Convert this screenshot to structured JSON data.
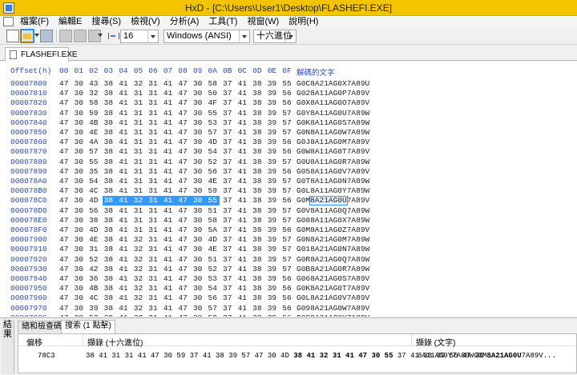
{
  "window": {
    "title": "HxD - [C:\\Users\\User1\\Desktop\\FLASHEFI.EXE]"
  },
  "menu": [
    "檔案(F)",
    "編輯E",
    "搜尋(S)",
    "檢視(V)",
    "分析(A)",
    "工具(T)",
    "視窗(W)",
    "說明(H)"
  ],
  "toolbar": {
    "bytes_per_row": "16",
    "charset": "Windows (ANSI)",
    "offset_base": "十六進位"
  },
  "file_tab": "FLASHEFI.EXE",
  "editor": {
    "offset_header": "Offset(h)",
    "column_headers": [
      "00",
      "01",
      "02",
      "03",
      "04",
      "05",
      "06",
      "07",
      "08",
      "09",
      "0A",
      "0B",
      "0C",
      "0D",
      "0E",
      "0F"
    ],
    "text_header": "解碼的文字",
    "rows": [
      {
        "offset": "00007800",
        "hex": [
          "47",
          "30",
          "43",
          "38",
          "41",
          "32",
          "31",
          "41",
          "47",
          "30",
          "58",
          "37",
          "41",
          "38",
          "39",
          "55"
        ],
        "text": "G0C8A21AG0X7A89U"
      },
      {
        "offset": "00007810",
        "hex": [
          "47",
          "30",
          "32",
          "38",
          "41",
          "31",
          "31",
          "41",
          "47",
          "30",
          "50",
          "37",
          "41",
          "38",
          "39",
          "56"
        ],
        "text": "G028A11AG0P7A89V"
      },
      {
        "offset": "00007820",
        "hex": [
          "47",
          "30",
          "58",
          "38",
          "41",
          "31",
          "31",
          "41",
          "47",
          "30",
          "4F",
          "37",
          "41",
          "38",
          "39",
          "56"
        ],
        "text": "G0X8A11AG0O7A89V"
      },
      {
        "offset": "00007830",
        "hex": [
          "47",
          "30",
          "59",
          "38",
          "41",
          "31",
          "31",
          "41",
          "47",
          "30",
          "55",
          "37",
          "41",
          "38",
          "39",
          "57"
        ],
        "text": "G0Y8A11AG0U7A89W"
      },
      {
        "offset": "00007840",
        "hex": [
          "47",
          "30",
          "4B",
          "38",
          "41",
          "31",
          "31",
          "41",
          "47",
          "30",
          "53",
          "37",
          "41",
          "38",
          "39",
          "57"
        ],
        "text": "G0K8A11AG0S7A89W"
      },
      {
        "offset": "00007850",
        "hex": [
          "47",
          "30",
          "4E",
          "38",
          "41",
          "31",
          "31",
          "41",
          "47",
          "30",
          "57",
          "37",
          "41",
          "38",
          "39",
          "57"
        ],
        "text": "G0N8A11AG0W7A89W"
      },
      {
        "offset": "00007860",
        "hex": [
          "47",
          "30",
          "4A",
          "38",
          "41",
          "31",
          "31",
          "41",
          "47",
          "30",
          "4D",
          "37",
          "41",
          "38",
          "39",
          "56"
        ],
        "text": "G0J8A11AG0M7A89V"
      },
      {
        "offset": "00007870",
        "hex": [
          "47",
          "30",
          "57",
          "38",
          "41",
          "31",
          "31",
          "41",
          "47",
          "30",
          "54",
          "37",
          "41",
          "38",
          "39",
          "56"
        ],
        "text": "G0W8A11AG0T7A89V"
      },
      {
        "offset": "00007880",
        "hex": [
          "47",
          "30",
          "55",
          "38",
          "41",
          "31",
          "31",
          "41",
          "47",
          "30",
          "52",
          "37",
          "41",
          "38",
          "39",
          "57"
        ],
        "text": "G0U8A11AG0R7A89W"
      },
      {
        "offset": "00007890",
        "hex": [
          "47",
          "30",
          "35",
          "38",
          "41",
          "31",
          "31",
          "41",
          "47",
          "30",
          "56",
          "37",
          "41",
          "38",
          "39",
          "56"
        ],
        "text": "G058A11AG0V7A89V"
      },
      {
        "offset": "000078A0",
        "hex": [
          "47",
          "30",
          "54",
          "38",
          "41",
          "31",
          "31",
          "41",
          "47",
          "30",
          "4E",
          "37",
          "41",
          "38",
          "39",
          "57"
        ],
        "text": "G0T8A11AG0N7A89W"
      },
      {
        "offset": "000078B0",
        "hex": [
          "47",
          "30",
          "4C",
          "38",
          "41",
          "31",
          "31",
          "41",
          "47",
          "30",
          "59",
          "37",
          "41",
          "38",
          "39",
          "57"
        ],
        "text": "G0L8A11AG0Y7A89W"
      },
      {
        "offset": "000078C0",
        "hex": [
          "47",
          "30",
          "4D",
          "38",
          "41",
          "32",
          "31",
          "41",
          "47",
          "30",
          "55",
          "37",
          "41",
          "38",
          "39",
          "56"
        ],
        "text": "G0M8A21AG0U7A89V",
        "selected": true
      },
      {
        "offset": "000078D0",
        "hex": [
          "47",
          "30",
          "56",
          "38",
          "41",
          "31",
          "31",
          "41",
          "47",
          "30",
          "51",
          "37",
          "41",
          "38",
          "39",
          "57"
        ],
        "text": "G0V8A11AG0Q7A89W"
      },
      {
        "offset": "000078E0",
        "hex": [
          "47",
          "30",
          "38",
          "38",
          "41",
          "31",
          "31",
          "41",
          "47",
          "30",
          "58",
          "37",
          "41",
          "38",
          "39",
          "57"
        ],
        "text": "G088A11AG0X7A89W"
      },
      {
        "offset": "000078F0",
        "hex": [
          "47",
          "30",
          "4D",
          "38",
          "41",
          "31",
          "31",
          "41",
          "47",
          "30",
          "5A",
          "37",
          "41",
          "38",
          "39",
          "56"
        ],
        "text": "G0M8A11AG0Z7A89V"
      },
      {
        "offset": "00007900",
        "hex": [
          "47",
          "30",
          "4E",
          "38",
          "41",
          "32",
          "31",
          "41",
          "47",
          "30",
          "4D",
          "37",
          "41",
          "38",
          "39",
          "57"
        ],
        "text": "G0N8A21AG0M7A89W"
      },
      {
        "offset": "00007910",
        "hex": [
          "47",
          "30",
          "31",
          "38",
          "41",
          "32",
          "31",
          "41",
          "47",
          "30",
          "4E",
          "37",
          "41",
          "38",
          "39",
          "57"
        ],
        "text": "G018A21AG0N7A89W"
      },
      {
        "offset": "00007920",
        "hex": [
          "47",
          "30",
          "52",
          "38",
          "41",
          "32",
          "31",
          "41",
          "47",
          "30",
          "51",
          "37",
          "41",
          "38",
          "39",
          "57"
        ],
        "text": "G0R8A21AG0Q7A89W"
      },
      {
        "offset": "00007930",
        "hex": [
          "47",
          "30",
          "42",
          "38",
          "41",
          "32",
          "31",
          "41",
          "47",
          "30",
          "52",
          "37",
          "41",
          "38",
          "39",
          "57"
        ],
        "text": "G0B8A21AG0R7A89W"
      },
      {
        "offset": "00007940",
        "hex": [
          "47",
          "30",
          "36",
          "38",
          "41",
          "32",
          "31",
          "41",
          "47",
          "30",
          "53",
          "37",
          "41",
          "38",
          "39",
          "56"
        ],
        "text": "G068A21AG0S7A89V"
      },
      {
        "offset": "00007950",
        "hex": [
          "47",
          "30",
          "4B",
          "38",
          "41",
          "32",
          "31",
          "41",
          "47",
          "30",
          "54",
          "37",
          "41",
          "38",
          "39",
          "56"
        ],
        "text": "G0K8A21AG0T7A89V"
      },
      {
        "offset": "00007960",
        "hex": [
          "47",
          "30",
          "4C",
          "38",
          "41",
          "32",
          "31",
          "41",
          "47",
          "30",
          "56",
          "37",
          "41",
          "38",
          "39",
          "56"
        ],
        "text": "G0L8A21AG0V7A89V"
      },
      {
        "offset": "00007970",
        "hex": [
          "47",
          "30",
          "39",
          "38",
          "41",
          "32",
          "31",
          "41",
          "47",
          "30",
          "57",
          "37",
          "41",
          "38",
          "39",
          "56"
        ],
        "text": "G098A21AG0W7A89V"
      },
      {
        "offset": "00007980",
        "hex": [
          "47",
          "30",
          "53",
          "38",
          "41",
          "32",
          "31",
          "41",
          "47",
          "30",
          "59",
          "37",
          "41",
          "38",
          "39",
          "56"
        ],
        "text": "G0S8A21AG0Y7A89V"
      }
    ]
  },
  "bottom": {
    "panel_label": "結果",
    "tabs": [
      "總和檢查碼",
      "搜索 (1 點擊)"
    ],
    "columns": [
      "偏移",
      "擷錄 (十六進位)",
      "擷錄 (文字)"
    ],
    "result": {
      "offset": "78C3",
      "hex_pre": "38 41 31 31 41 47 30 59 37 41 38 39 57 47 30 4D ",
      "hex_match": "38 41 32 31 41 47 30 55",
      "hex_post": " 37 41 38 39 56 47 30 ...",
      "text_pre": "8A11AG0Y7A89WG0M",
      "text_match": "8A21AG0U",
      "text_post": "7A89V..."
    }
  }
}
